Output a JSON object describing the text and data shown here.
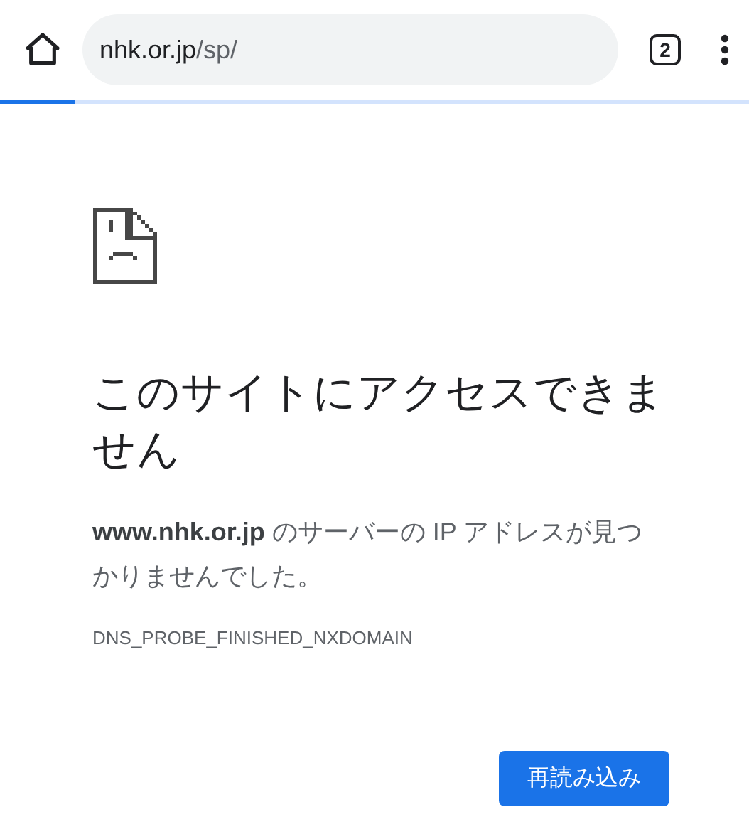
{
  "toolbar": {
    "url_host": "nhk.or.jp",
    "url_path": "/sp/",
    "tab_count": "2",
    "progress": {
      "level": 0.1
    }
  },
  "error": {
    "title": "このサイトにアクセスできません",
    "message": "**www.nhk.or.jp** のサーバーの IP アドレスが見つかりませんでした。",
    "code": "DNS_PROBE_FINISHED_NXDOMAIN",
    "buttons": [
      "再読み込み"
    ]
  }
}
